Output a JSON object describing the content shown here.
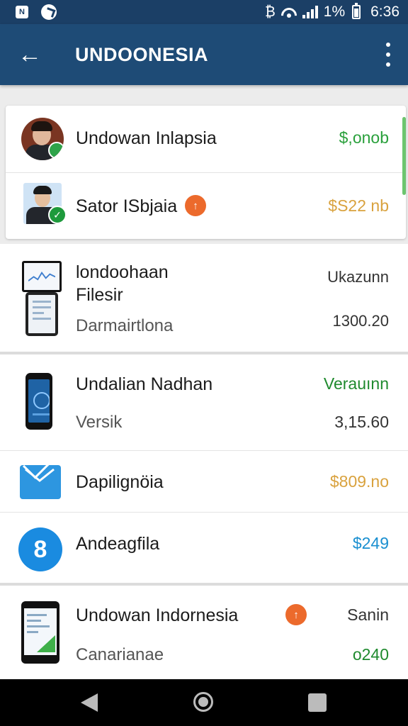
{
  "status_bar": {
    "notif_icon_text": "N",
    "battery_text": "1%",
    "time": "6:36",
    "extra_glyph": "₿"
  },
  "app_bar": {
    "title": "UNDOONESIA",
    "back_glyph": "←"
  },
  "card_items": [
    {
      "title": "Undowan Inlapsia",
      "amount": "$,onob",
      "amount_color": "#2aa03c"
    },
    {
      "title": "Sator ISbjaia",
      "amount": "$S22 nb",
      "amount_color": "#d9a23e",
      "badge_glyph": "↑"
    }
  ],
  "items": [
    {
      "title_line1": "londoohaan",
      "title_line2": "Filesir",
      "subtitle": "Darmairtlona",
      "top_right": "Ukazunn",
      "amount": "1300.20"
    },
    {
      "title": "Undalian Nadhan",
      "subtitle": "Versik",
      "top_right": "Verauınn",
      "top_right_color": "#1f8a2e",
      "amount": "3,15.60"
    },
    {
      "title": "Dapilignöia",
      "amount": "$809.no",
      "amount_color": "#d9a23e"
    },
    {
      "title": "Andeagfila",
      "amount": "$249",
      "amount_color": "#1a8fd0",
      "icon_glyph": "8"
    },
    {
      "title": "Undowan Indornesia",
      "subtitle": "Canarianae",
      "top_right": "Sanin",
      "amount": "o240",
      "amount_color": "#1f8a2e",
      "badge_glyph": "↑"
    }
  ]
}
